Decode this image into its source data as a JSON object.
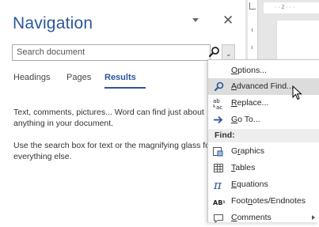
{
  "nav": {
    "title": "Navigation",
    "search_placeholder": "Search document",
    "tabs": [
      {
        "label": "Headings"
      },
      {
        "label": "Pages"
      },
      {
        "label": "Results"
      }
    ],
    "message_1": "Text, comments, pictures... Word can find just about anything in your document.",
    "message_2": "Use the search box for text or the magnifying glass for everything else.",
    "accent_color": "#2b579a"
  },
  "ruler": {
    "label": "· · 2 · · ·"
  },
  "menu": {
    "options": {
      "label": "Options...",
      "underline": "O",
      "rest": "ptions..."
    },
    "advanced_find": {
      "label": "Advanced Find...",
      "underline": "A",
      "rest": "dvanced Find...",
      "icon": "search-icon"
    },
    "replace": {
      "label": "Replace...",
      "underline": "R",
      "rest": "eplace...",
      "icon": "replace-icon"
    },
    "goto": {
      "label": "Go To...",
      "underline": "G",
      "rest": "o To...",
      "icon": "arrow-right-icon"
    },
    "find_header": "Find:",
    "graphics": {
      "label": "Graphics",
      "before": "G",
      "underline": "r",
      "rest": "aphics",
      "icon": "graphics-icon"
    },
    "tables": {
      "label": "Tables",
      "underline": "T",
      "rest": "ables",
      "icon": "table-icon"
    },
    "equations": {
      "label": "Equations",
      "underline": "E",
      "rest": "quations",
      "icon": "pi-icon"
    },
    "footnotes": {
      "label": "Footnotes/Endnotes",
      "before": "Foot",
      "underline": "n",
      "rest": "otes/Endnotes",
      "icon": "footnote-icon",
      "icon_text": "AB¹"
    },
    "comments": {
      "label": "Comments",
      "underline": "C",
      "rest": "omments",
      "icon": "comment-icon"
    }
  }
}
